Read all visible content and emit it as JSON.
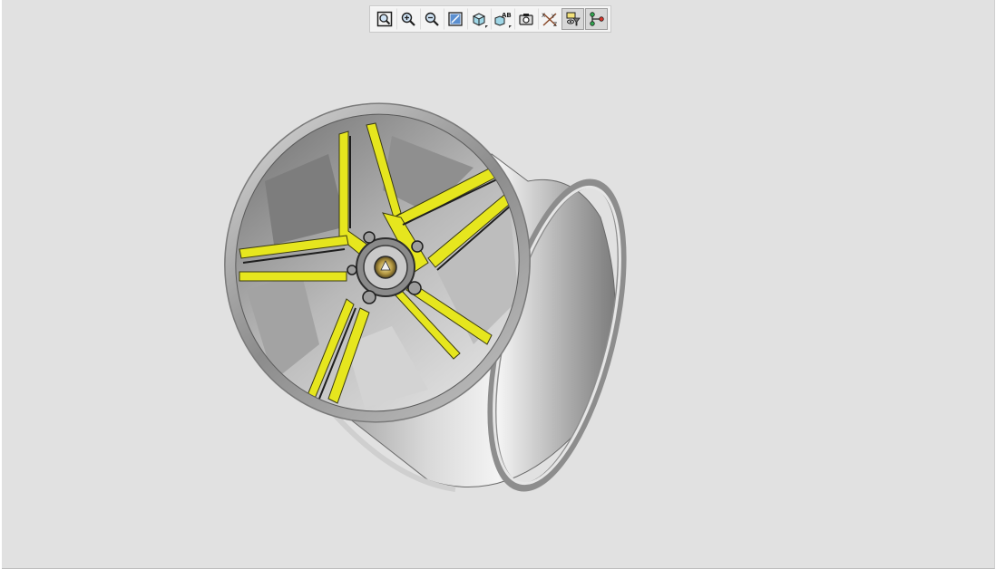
{
  "viewer": {
    "background": "#e1e1e1",
    "toolbar": {
      "buttons": [
        {
          "id": "zoom-fit",
          "icon": "zoom-fit-icon",
          "active": false
        },
        {
          "id": "zoom-in",
          "icon": "zoom-in-icon",
          "active": false
        },
        {
          "id": "zoom-out",
          "icon": "zoom-out-icon",
          "active": false
        },
        {
          "id": "zoom-window",
          "icon": "zoom-window-icon",
          "active": false
        },
        {
          "id": "view-orientation",
          "icon": "cube-view-icon",
          "active": false,
          "flyout": true
        },
        {
          "id": "label-view",
          "icon": "ab-label-icon",
          "active": false,
          "flyout": true
        },
        {
          "id": "screenshot",
          "icon": "camera-icon",
          "active": false
        },
        {
          "id": "explode",
          "icon": "explode-axes-icon",
          "active": false
        },
        {
          "id": "visibility",
          "icon": "visibility-funnel-icon",
          "active": true
        },
        {
          "id": "connections",
          "icon": "node-tree-icon",
          "active": true
        }
      ]
    },
    "model": {
      "name_icon": "wheel-rim-3d-model",
      "accent_color": "#e6e61e",
      "metal_color": "#b5b5b5"
    }
  }
}
